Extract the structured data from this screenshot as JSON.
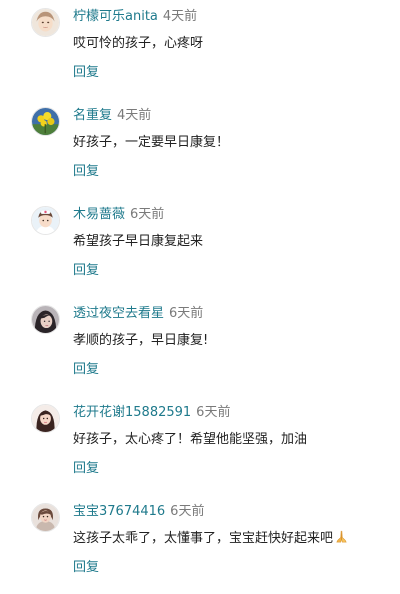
{
  "comments": [
    {
      "username": "柠檬可乐anita",
      "time": "4天前",
      "text": "哎可怜的孩子，心疼呀",
      "reply_label": "回复",
      "avatar_icon": "avatar-girl-pale-icon"
    },
    {
      "username": "名重复",
      "time": "4天前",
      "text": "好孩子，一定要早日康复！",
      "reply_label": "回复",
      "avatar_icon": "avatar-yellow-flowers-icon"
    },
    {
      "username": "木易蔷薇",
      "time": "6天前",
      "text": "希望孩子早日康复起来",
      "reply_label": "回复",
      "avatar_icon": "avatar-nurse-cap-icon"
    },
    {
      "username": "透过夜空去看星",
      "time": "6天前",
      "text": "孝顺的孩子，早日康复!",
      "reply_label": "回复",
      "avatar_icon": "avatar-dark-hair-icon"
    },
    {
      "username": "花开花谢15882591",
      "time": "6天前",
      "text": "好孩子，太心疼了！希望他能坚强，加油",
      "reply_label": "回复",
      "avatar_icon": "avatar-long-hair-icon"
    },
    {
      "username": "宝宝37674416",
      "time": "6天前",
      "text": "这孩子太乖了，太懂事了，宝宝赶快好起来吧",
      "reply_label": "回复",
      "avatar_icon": "avatar-woman-icon",
      "trailing_emoji": "praying-hands-icon"
    }
  ],
  "colors": {
    "username": "#1f7a8c",
    "reply": "#1f7a8c",
    "time": "#7a7a7a",
    "text": "#222222"
  }
}
